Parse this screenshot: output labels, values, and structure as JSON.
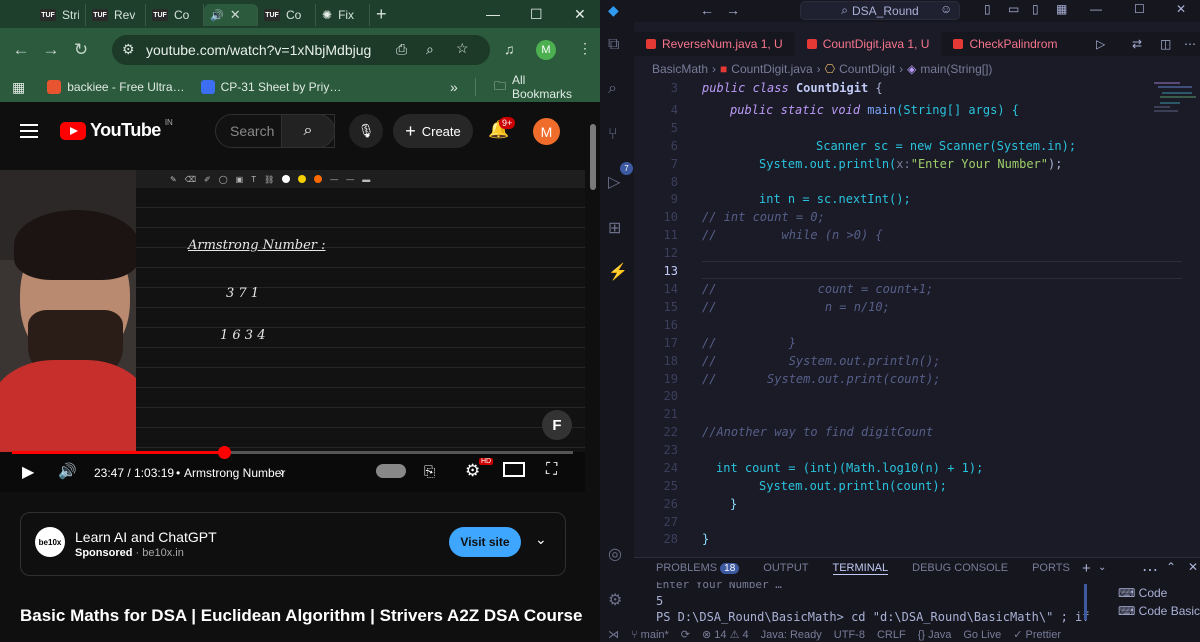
{
  "chrome": {
    "tabs": [
      {
        "label": "Stri",
        "favicon": "TUF"
      },
      {
        "label": "Rev",
        "favicon": "TUF"
      },
      {
        "label": "Co",
        "favicon": "TUF"
      },
      {
        "label": "",
        "favicon": "audio",
        "active": true
      },
      {
        "label": "Co",
        "favicon": "TUF"
      },
      {
        "label": "Fix",
        "favicon": "openai"
      }
    ],
    "new_tab": "+",
    "url": "youtube.com/watch?v=1xNbjMdbjug",
    "profile_initial": "M",
    "bookmarks": [
      {
        "label": "backiee - Free Ultra…",
        "color": "#e8542f"
      },
      {
        "label": "CP-31 Sheet by Priy…",
        "color": "#3b6ef0"
      }
    ],
    "bookmarks_overflow": "»",
    "all_bookmarks": "All Bookmarks"
  },
  "youtube": {
    "logo_text": "YouTube",
    "logo_country": "IN",
    "search_placeholder": "Search",
    "create_label": "Create",
    "notif_count": "9+",
    "avatar_initial": "M",
    "whiteboard": {
      "heading": "Armstrong Number :",
      "line1": "3 7 1",
      "line2": "1 6 3 4"
    },
    "progress": 0.378,
    "time": "23:47 / 1:03:19",
    "chapter": "Armstrong Number",
    "hd_badge": "HD",
    "ad": {
      "logo_text": "be10x",
      "title": "Learn AI and ChatGPT",
      "sponsored": "Sponsored",
      "domain": "be10x.in",
      "cta": "Visit site"
    },
    "video_title": "Basic Maths for DSA | Euclidean Algorithm | Strivers A2Z DSA Course"
  },
  "vscode": {
    "command_center": "DSA_Round",
    "tabs": [
      {
        "label": "ReverseNum.java 1, U"
      },
      {
        "label": "CountDigit.java 1, U",
        "active": true
      },
      {
        "label": "CheckPalindrom"
      }
    ],
    "breadcrumb": [
      "BasicMath",
      "CountDigit.java",
      "CountDigit",
      "main(String[])"
    ],
    "git_badge": "7",
    "lines": [
      "3",
      "4",
      "5",
      "6",
      "7",
      "8",
      "9",
      "10",
      "11",
      "12",
      "13",
      "14",
      "15",
      "16",
      "17",
      "18",
      "19",
      "20",
      "21",
      "22",
      "23",
      "24",
      "25",
      "26",
      "27",
      "28"
    ],
    "code": {
      "l3": {
        "kw": "public class",
        "cls": "CountDigit",
        "rest": " {"
      },
      "l4": {
        "kw": "public static void",
        "fn": "main",
        "args": "(String[] args) {"
      },
      "l6": "Scanner sc = new Scanner(System.in);",
      "l7_pre": "System.out.println(",
      "l7_hint": "x:",
      "l7_str": "\"Enter Your Number\"",
      "l7_post": ");",
      "l9": "int n = sc.nextInt();",
      "l10": "// int count = 0;",
      "l11": "//         while (n >0) {",
      "l14": "//              count = count+1;",
      "l15": "//               n = n/10;",
      "l17": "//          }",
      "l18": "//          System.out.println();",
      "l19": "//       System.out.print(count);",
      "l22": "//Another way to find digitCount",
      "l24": "int count = (int)(Math.log10(n) + 1);",
      "l25": "System.out.println(count);",
      "l26": "}",
      "l28": "}"
    },
    "panel": {
      "tabs": [
        "PROBLEMS",
        "OUTPUT",
        "TERMINAL",
        "DEBUG CONSOLE",
        "PORTS"
      ],
      "problems_count": "18",
      "term_line0": "Enter Your Number …",
      "term_line1": "5",
      "term_line2": "PS D:\\DSA_Round\\BasicMath> cd \"d:\\DSA_Round\\BasicMath\\\" ; if",
      "terminals": [
        "Code",
        "Code Basic..."
      ]
    },
    "status": {
      "branch": "main*",
      "problems": "⊗ 14 ⚠ 4",
      "java": "Java: Ready",
      "encoding": "UTF-8",
      "eol": "CRLF",
      "lang": "{} Java",
      "golive": "Go Live",
      "prettier": "✓ Prettier"
    }
  }
}
